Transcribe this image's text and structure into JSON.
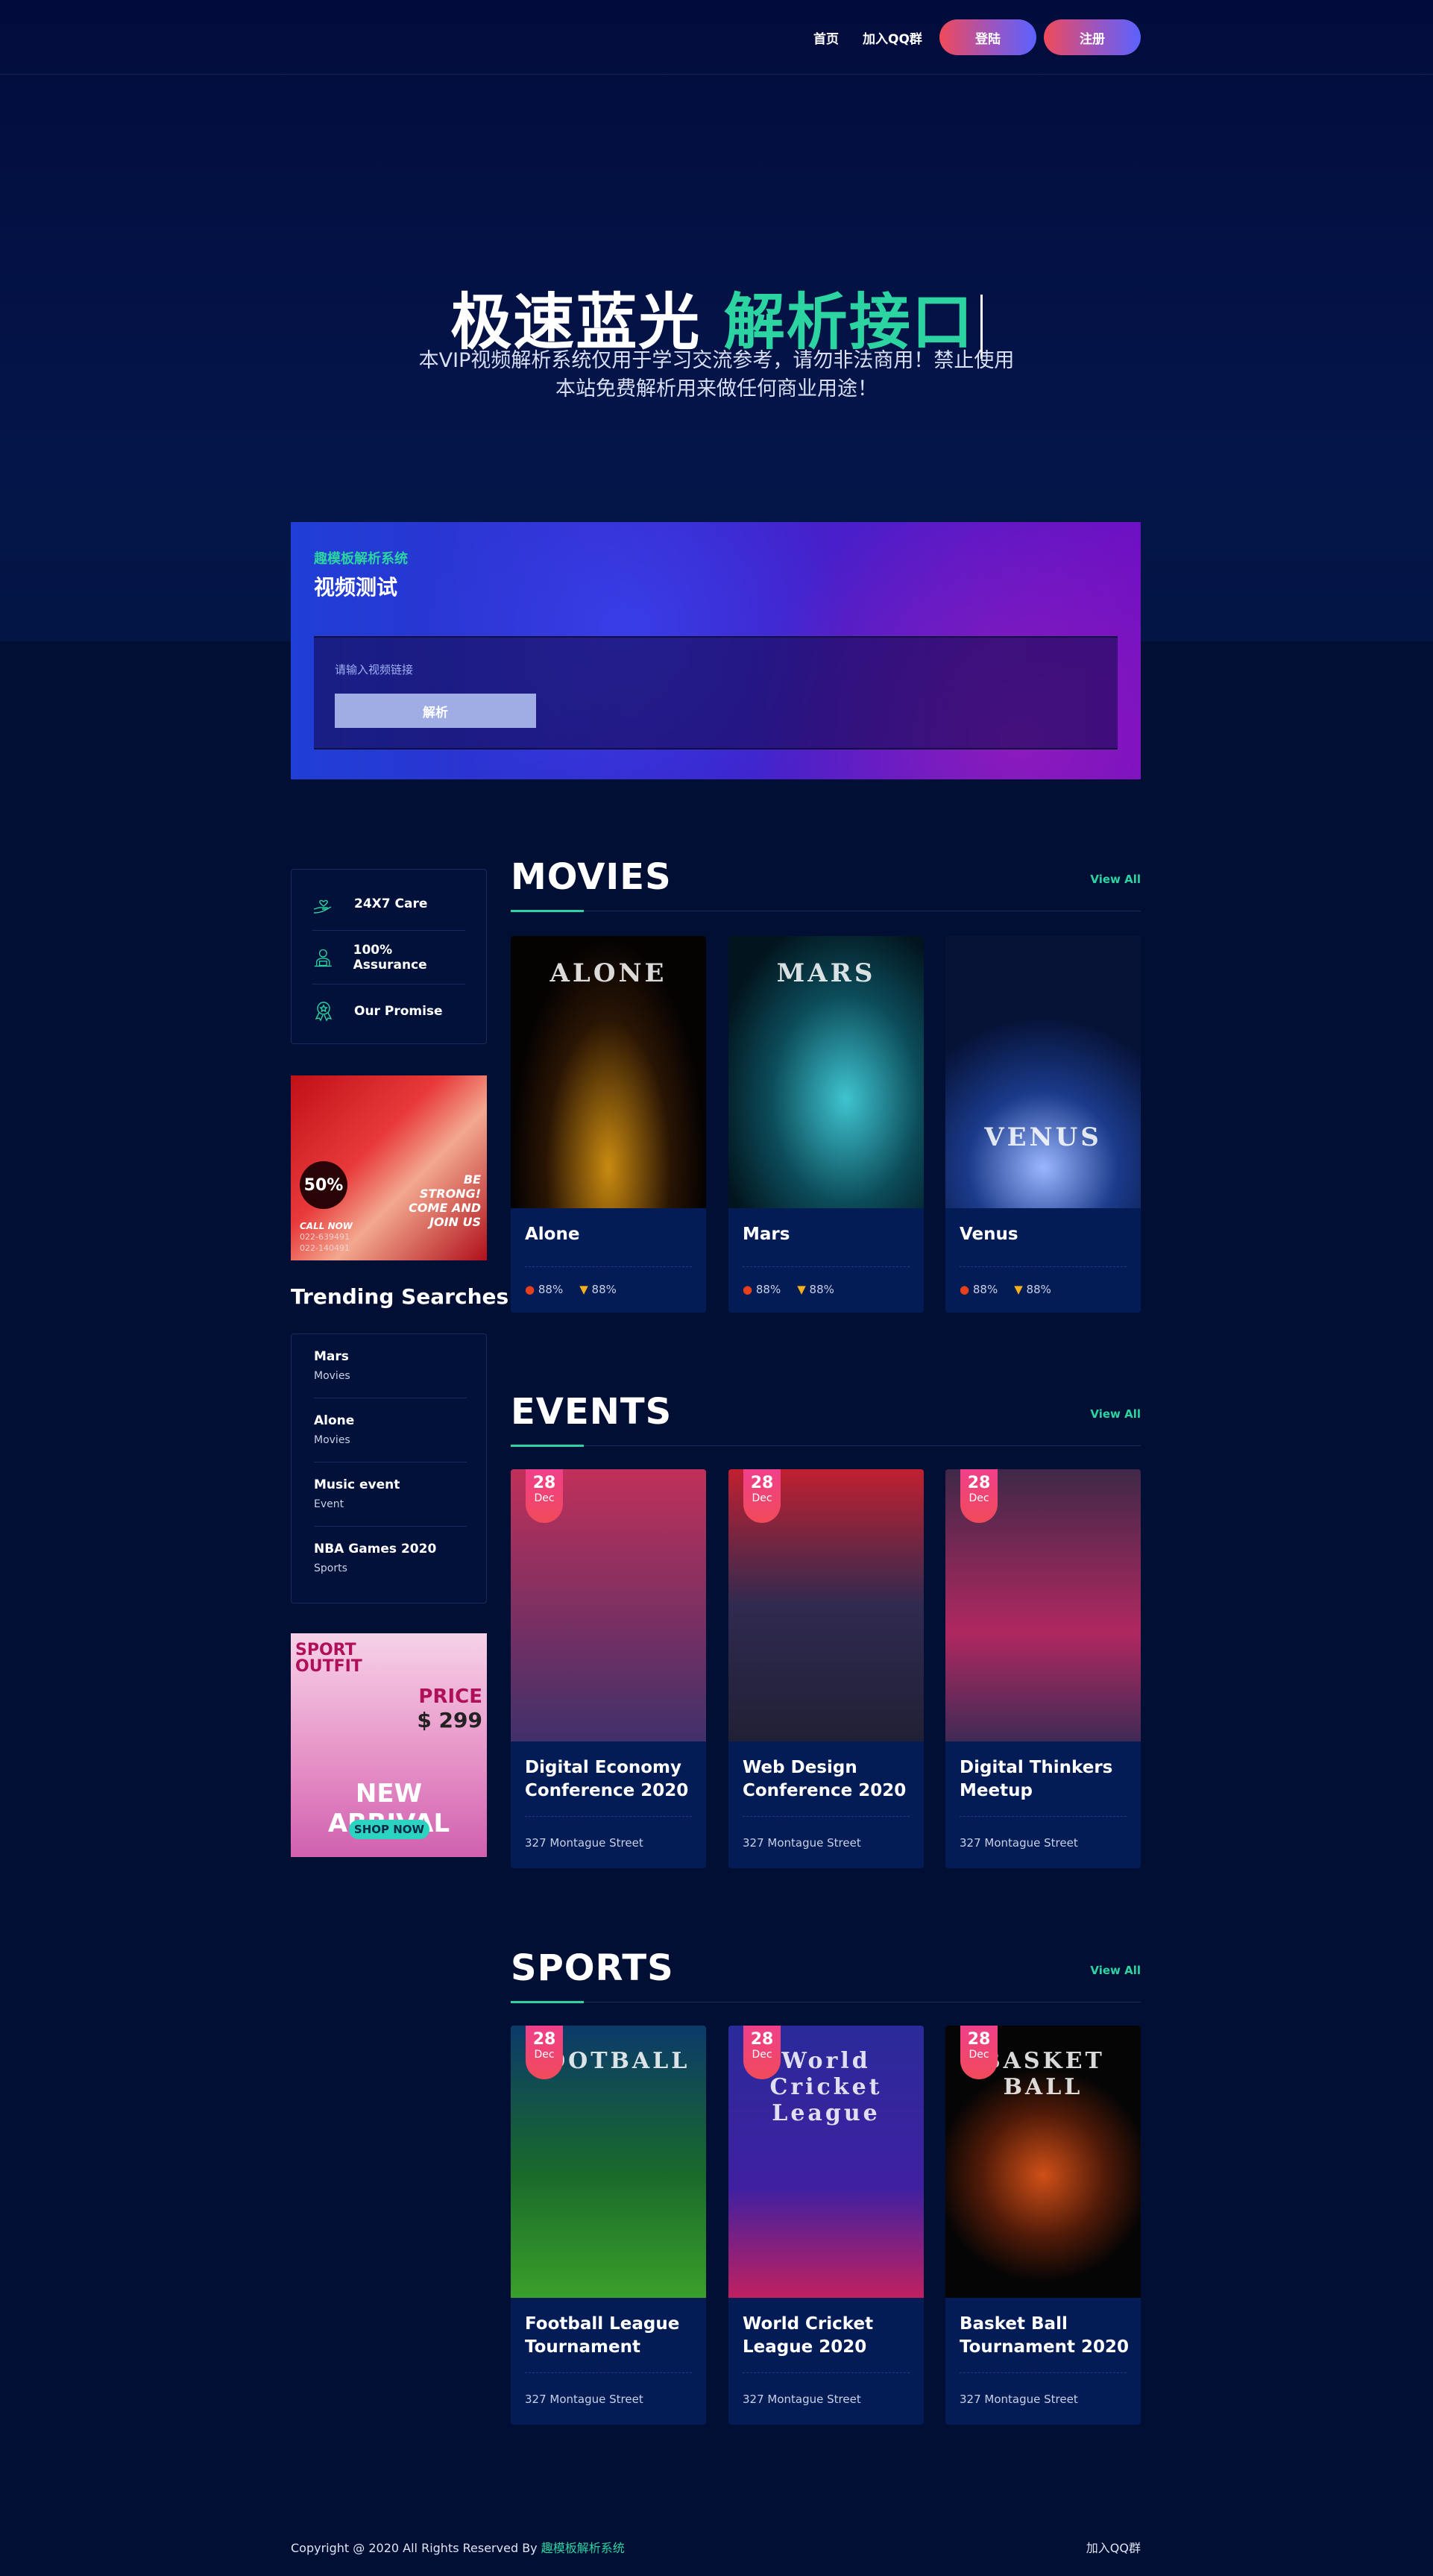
{
  "nav": {
    "links": [
      "首页",
      "加入QQ群"
    ],
    "login": "登陆",
    "register": "注册"
  },
  "hero": {
    "title_white": "极速蓝光",
    "title_green": "解析接口",
    "subtitle_line1": "本VIP视频解析系统仅用于学习交流参考，请勿非法商用！禁止使用",
    "subtitle_line2": "本站免费解析用来做任何商业用途！"
  },
  "parser": {
    "brand": "趣模板解析系统",
    "title": "视频测试",
    "placeholder": "请输入视频链接",
    "button": "解析"
  },
  "sidebar": {
    "features": [
      {
        "label": "24X7 Care",
        "icon": "heart-hand-icon"
      },
      {
        "label": "100% Assurance",
        "icon": "support-agent-icon"
      },
      {
        "label": "Our Promise",
        "icon": "award-ribbon-icon"
      }
    ],
    "ad1": {
      "discount": "50%",
      "slogan": "BE STRONG! COME AND JOIN US",
      "call": "CALL NOW",
      "phones": [
        "022-639491",
        "022-140491"
      ]
    },
    "trending_title": "Trending Searches",
    "trending": [
      {
        "name": "Mars",
        "cat": "Movies"
      },
      {
        "name": "Alone",
        "cat": "Movies"
      },
      {
        "name": "Music event",
        "cat": "Event"
      },
      {
        "name": "NBA Games 2020",
        "cat": "Sports"
      }
    ],
    "ad2": {
      "top": "SPORT OUTFIT",
      "price_label": "PRICE",
      "price": "$ 299",
      "headline": "NEW ARRIVAL",
      "cta": "SHOP NOW"
    }
  },
  "movies": {
    "heading": "MOVIES",
    "view_all": "View All",
    "items": [
      {
        "title": "Alone",
        "poster_text": "ALONE",
        "tomato": "88%",
        "popcorn": "88%"
      },
      {
        "title": "Mars",
        "poster_text": "MARS",
        "tomato": "88%",
        "popcorn": "88%"
      },
      {
        "title": "Venus",
        "poster_text": "VENUS",
        "tomato": "88%",
        "popcorn": "88%"
      }
    ]
  },
  "events": {
    "heading": "EVENTS",
    "view_all": "View All",
    "items": [
      {
        "day": "28",
        "month": "Dec",
        "title": "Digital Economy Conference 2020",
        "address": "327 Montague Street"
      },
      {
        "day": "28",
        "month": "Dec",
        "title": "Web Design Conference 2020",
        "address": "327 Montague Street"
      },
      {
        "day": "28",
        "month": "Dec",
        "title": "Digital Thinkers Meetup",
        "address": "327 Montague Street"
      }
    ]
  },
  "sports": {
    "heading": "SPORTS",
    "view_all": "View All",
    "items": [
      {
        "day": "28",
        "month": "Dec",
        "title": "Football League Tournament",
        "poster_text": "FOOTBALL",
        "address": "327 Montague Street"
      },
      {
        "day": "28",
        "month": "Dec",
        "title": "World Cricket League 2020",
        "poster_text": "World Cricket League",
        "address": "327 Montague Street"
      },
      {
        "day": "28",
        "month": "Dec",
        "title": "Basket Ball Tournament 2020",
        "poster_text": "BASKET BALL",
        "address": "327 Montague Street"
      }
    ]
  },
  "footer": {
    "copyright": "Copyright @ 2020 All Rights Reserved By ",
    "brand": "趣模板解析系统",
    "link": "加入QQ群"
  },
  "colors": {
    "accent": "#2bd4a0",
    "background": "#010f3a",
    "card": "#041c56",
    "badge": "#f0408a"
  }
}
